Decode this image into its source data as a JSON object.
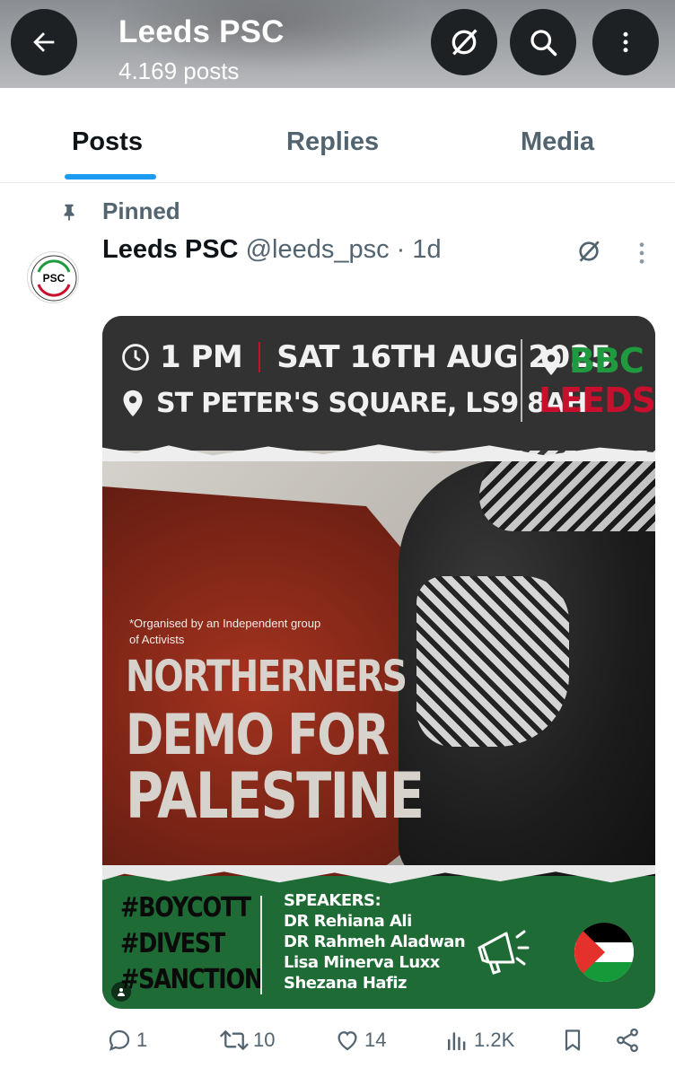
{
  "header": {
    "title": "Leeds PSC",
    "subtitle": "4.169 posts"
  },
  "tabs": [
    {
      "label": "Posts",
      "active": true
    },
    {
      "label": "Replies",
      "active": false
    },
    {
      "label": "Media",
      "active": false
    }
  ],
  "pinned": {
    "label": "Pinned"
  },
  "post": {
    "author_name": "Leeds PSC",
    "author_handle": "@leeds_psc",
    "separator": "·",
    "time": "1d",
    "avatar_text": "PSC",
    "poster": {
      "time": "1 PM",
      "date": "SAT 16TH AUG 2025",
      "location": "ST PETER'S SQUARE, LS9 8AH",
      "venue_line1": "BBC",
      "venue_line2": "LEEDS",
      "note": "*Organised by an Independent group of Activists",
      "headline1": "NORTHERNERS",
      "headline2": "DEMO FOR",
      "headline3": "PALESTINE",
      "tag1": "#BOYCOTT",
      "tag2": "#DIVEST",
      "tag3": "#SANCTION",
      "speakers_heading": "SPEAKERS:",
      "speaker1": "DR Rehiana Ali",
      "speaker2": "DR Rahmeh Aladwan",
      "speaker3": "Lisa Minerva Luxx",
      "speaker4": "Shezana Hafiz",
      "colors": {
        "green": "#1f6b35",
        "red": "#c8102e",
        "bbc_green": "#1f9a3e"
      }
    },
    "actions": {
      "replies": "1",
      "reposts": "10",
      "likes": "14",
      "views": "1.2K"
    }
  },
  "colors": {
    "accent": "#1d9bf0",
    "secondary_text": "#536471",
    "header_button": "#1e2124"
  }
}
